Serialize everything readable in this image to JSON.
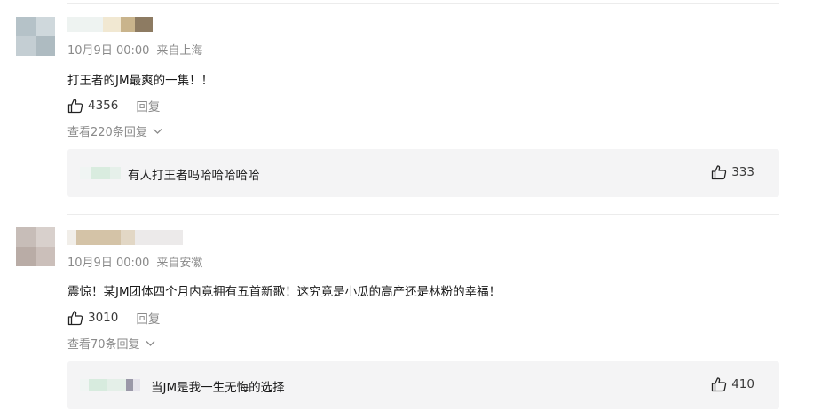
{
  "comments": [
    {
      "time": "10月9日 00:00",
      "location": "来自上海",
      "text": "打王者的JM最爽的一集！！",
      "likes": "4356",
      "reply_label": "回复",
      "view_replies": "查看220条回复",
      "reply": {
        "text": "有人打王者吗哈哈哈哈哈",
        "likes": "333"
      }
    },
    {
      "time": "10月9日 00:00",
      "location": "来自安徽",
      "text": "震惊！某JM团体四个月内竟拥有五首新歌！这究竟是小瓜的高产还是林粉的幸福！",
      "likes": "3010",
      "reply_label": "回复",
      "view_replies": "查看70条回复",
      "reply": {
        "text": "当JM是我一生无悔的选择",
        "likes": "410"
      }
    }
  ],
  "icons": {
    "like": "thumbs-up-outline-icon",
    "expand": "chevron-down-icon"
  },
  "colors": {
    "meta_text": "#8a8a8a",
    "reply_box_bg": "#f4f4f5"
  }
}
